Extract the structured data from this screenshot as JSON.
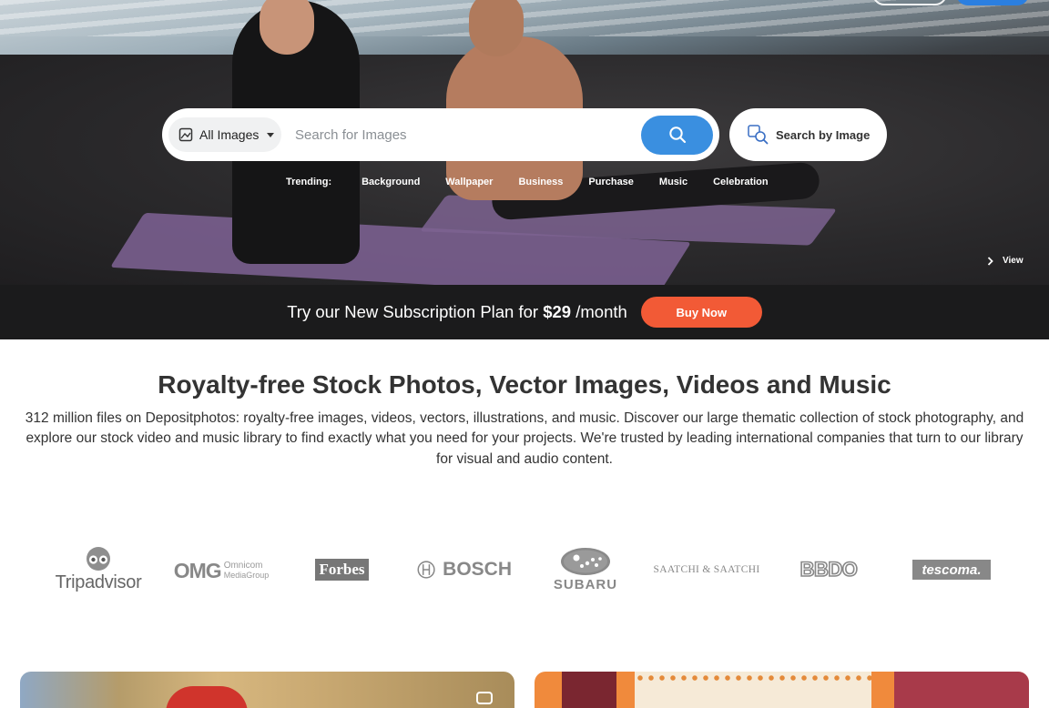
{
  "search": {
    "category": "All Images",
    "placeholder": "Search for Images",
    "search_by_image_label": "Search by Image"
  },
  "trending": {
    "label": "Trending:",
    "tags": [
      "Background",
      "Wallpaper",
      "Business",
      "Purchase",
      "Music",
      "Celebration"
    ]
  },
  "hero": {
    "view_label": "View"
  },
  "promo": {
    "text_prefix": "Try our New Subscription Plan for ",
    "price": "$29",
    "text_suffix": " /month",
    "button_label": "Buy Now"
  },
  "main": {
    "headline": "Royalty-free Stock Photos, Vector Images, Videos and Music",
    "description": "312 million files on Depositphotos: royalty-free images, videos, vectors, illustrations, and music. Discover our large thematic collection of stock photography, and explore our stock video and music library to find exactly what you need for your projects. We're trusted by leading international companies that turn to our library for visual and audio content."
  },
  "logos": {
    "tripadvisor": "Tripadvisor",
    "omg": "OMG",
    "omg_sub1": "Omnicom",
    "omg_sub2": "MediaGroup",
    "forbes": "Forbes",
    "bosch": "BOSCH",
    "subaru": "SUBARU",
    "saatchi": "SAATCHI & SAATCHI",
    "bbdo": "BBDO",
    "tescoma": "tescoma."
  },
  "colors": {
    "accent_blue": "#3a8fe0",
    "promo_orange": "#f25a36",
    "promo_bg": "#1b1b1c"
  }
}
